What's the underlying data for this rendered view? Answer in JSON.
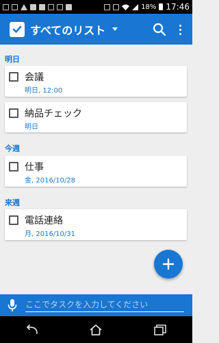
{
  "status_bar": {
    "battery": "18%",
    "time": "17:46"
  },
  "app_bar": {
    "title": "すべてのリスト"
  },
  "sections": [
    {
      "header": "明日",
      "tasks": [
        {
          "title": "会議",
          "date": "明日, 12:00"
        },
        {
          "title": "納品チェック",
          "date": "明日"
        }
      ]
    },
    {
      "header": "今週",
      "tasks": [
        {
          "title": "仕事",
          "date": "金, 2016/10/28"
        }
      ]
    },
    {
      "header": "来週",
      "tasks": [
        {
          "title": "電話連絡",
          "date": "月, 2016/10/31"
        }
      ]
    }
  ],
  "input_bar": {
    "placeholder": "ここでタスクを入力してください"
  },
  "colors": {
    "primary": "#1976d2",
    "background": "#eeeeee"
  }
}
